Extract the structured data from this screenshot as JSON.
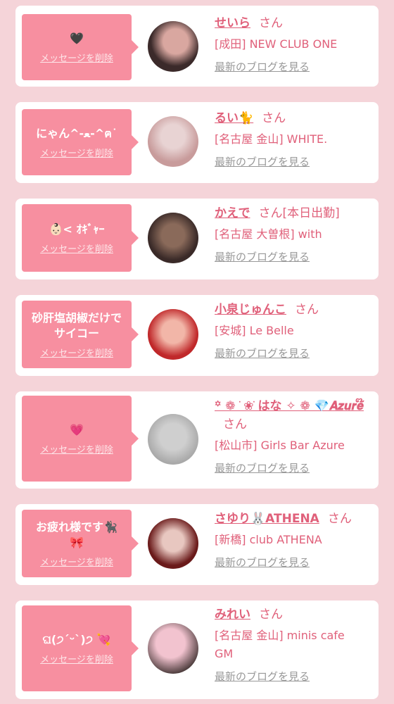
{
  "items": [
    {
      "message": "🖤",
      "delete_label": "メッセージを削除",
      "name": "せいら",
      "honorific": "さん",
      "extra": "",
      "shop": "[成田] NEW CLUB ONE",
      "blog_label": "最新のブログを見る",
      "avatar_colors": [
        "#3b2a2a",
        "#d9a7a0"
      ]
    },
    {
      "message": "にゃん^-ﻌ-^ฅ˙",
      "delete_label": "メッセージを削除",
      "name": "るい🐈",
      "honorific": "さん",
      "extra": "",
      "shop": "[名古屋 金山] WHITE.",
      "blog_label": "最新のブログを見る",
      "avatar_colors": [
        "#c89b9b",
        "#e8d3d3"
      ]
    },
    {
      "message": "👶🏻< ｵｷﾞｬｰ",
      "delete_label": "メッセージを削除",
      "name": "かえで",
      "honorific": "さん",
      "extra": "[本日出勤]",
      "shop": "[名古屋 大曽根] with",
      "blog_label": "最新のブログを見る",
      "avatar_colors": [
        "#3a2a28",
        "#8a6a5a"
      ]
    },
    {
      "message": "砂肝塩胡椒だけで\nサイコー",
      "delete_label": "メッセージを削除",
      "name": "小泉じゅんこ",
      "honorific": "さん",
      "extra": "",
      "shop": "[安城] Le Belle",
      "blog_label": "最新のブログを見る",
      "avatar_colors": [
        "#c0282a",
        "#f2b6a8"
      ]
    },
    {
      "message": "💗",
      "delete_label": "メッセージを削除",
      "name": "꙳ ❁ ֹ ❀ ֹはな ✧ ❁ 💎𝑨𝒛𝒖𝒓𝒆໊",
      "honorific": "さん",
      "extra": "",
      "shop": "[松山市] Girls Bar Azure",
      "blog_label": "最新のブログを見る",
      "avatar_colors": [
        "#cfcfcf",
        "#a9a9a9"
      ]
    },
    {
      "message": "お疲れ様です🐈‍⬛\n🎀",
      "delete_label": "メッセージを削除",
      "name": "さゆり🐰ATHENA",
      "honorific": "さん",
      "extra": "",
      "shop": "[新橋] club ATHENA",
      "blog_label": "最新のブログを見る",
      "avatar_colors": [
        "#6a1a1a",
        "#e8c7c0"
      ]
    },
    {
      "message": "ଘ(੭ˊᵕˋ)੭ 💘",
      "delete_label": "メッセージを削除",
      "name": "みれい",
      "honorific": "さん",
      "extra": "",
      "shop": "[名古屋 金山] minis cafe\nGM",
      "blog_label": "最新のブログを見る",
      "avatar_colors": [
        "#f2c3cf",
        "#4a3a3a"
      ]
    }
  ]
}
